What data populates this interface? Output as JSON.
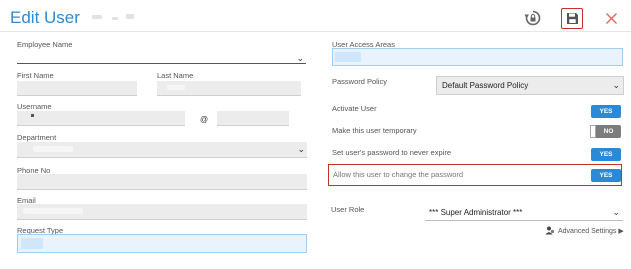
{
  "header": {
    "title": "Edit User",
    "actions": {
      "reset_icon": "reset-lock-icon",
      "save_icon": "save-icon",
      "close_icon": "close-icon",
      "close_color": "#e06a5f"
    }
  },
  "left": {
    "employee_name_label": "Employee Name",
    "first_name_label": "First Name",
    "last_name_label": "Last Name",
    "username_label": "Username",
    "at_sign": "@",
    "department_label": "Department",
    "phone_label": "Phone No",
    "email_label": "Email",
    "request_type_label": "Request Type"
  },
  "right": {
    "user_access_areas_label": "User Access Areas",
    "password_policy_label": "Password Policy",
    "password_policy_value": "Default Password Policy",
    "activate_user_label": "Activate User",
    "activate_user_state": "YES",
    "temporary_label": "Make this user temporary",
    "temporary_state": "NO",
    "never_expire_label": "Set user's password to never expire",
    "never_expire_state": "YES",
    "allow_change_label": "Allow this user to change the password",
    "allow_change_state": "YES",
    "user_role_label": "User Role",
    "user_role_value": "*** Super Administrator ***",
    "advanced_settings": "Advanced Settings ▶"
  },
  "colors": {
    "accent": "#2b8ad8",
    "highlight": "#c9302c",
    "toggle_off": "#7d7d7d"
  }
}
